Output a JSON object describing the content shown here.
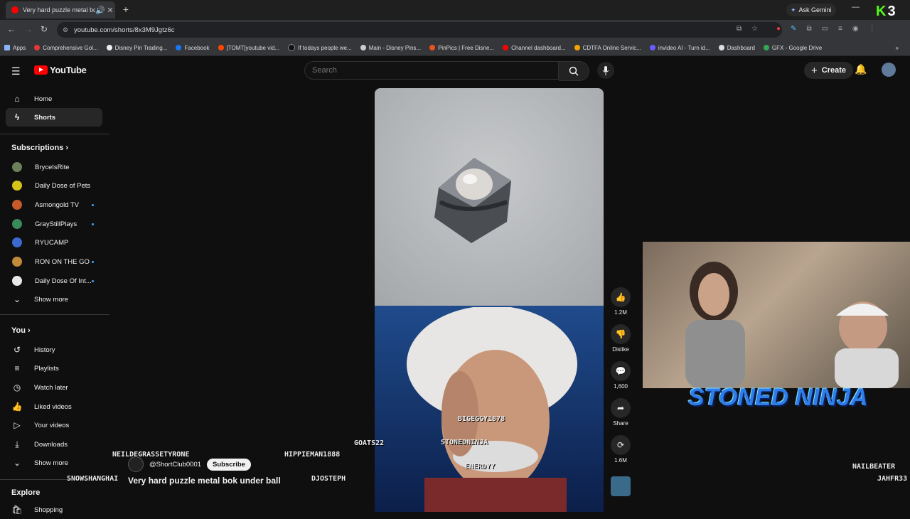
{
  "browser": {
    "tab_title": "Very hard puzzle metal bok",
    "ask_gemini": "Ask Gemini",
    "url": "youtube.com/shorts/8x3M9Jgtz6c",
    "bookmarks": [
      {
        "label": "Apps",
        "color": "#8ab4f8"
      },
      {
        "label": "Comprehensive Gol...",
        "color": "#e53935"
      },
      {
        "label": "Disney Pin Trading...",
        "color": "#eeeeee"
      },
      {
        "label": "Facebook",
        "color": "#1877f2"
      },
      {
        "label": "[TOMT]youtube vid...",
        "color": "#ff4500"
      },
      {
        "label": "If todays people we...",
        "color": "#111111"
      },
      {
        "label": "Main - Disney Pins...",
        "color": "#cccccc"
      },
      {
        "label": "PinPics | Free Disne...",
        "color": "#e8531f"
      },
      {
        "label": "Channel dashboard...",
        "color": "#ff0000"
      },
      {
        "label": "CDTFA Online Servic...",
        "color": "#f4a300"
      },
      {
        "label": "invideo AI - Turn id...",
        "color": "#6b5cff"
      },
      {
        "label": "Dashboard",
        "color": "#dddddd"
      },
      {
        "label": "GFX - Google Drive",
        "color": "#34a853"
      }
    ]
  },
  "header": {
    "logo_text": "YouTube",
    "search_placeholder": "Search",
    "create_label": "Create"
  },
  "sidebar": {
    "home": "Home",
    "shorts": "Shorts",
    "subscriptions_title": "Subscriptions",
    "subscriptions": [
      {
        "name": "BryceIsRite",
        "color": "#6a7f5a",
        "live": false
      },
      {
        "name": "Daily Dose of Pets",
        "color": "#d4c41a",
        "live": false
      },
      {
        "name": "Asmongold TV",
        "color": "#c55a2a",
        "live": true
      },
      {
        "name": "GrayStillPlays",
        "color": "#3a8a5a",
        "live": true
      },
      {
        "name": "RYUCAMP",
        "color": "#3a6ad0",
        "live": false
      },
      {
        "name": "RON ON THE GO",
        "color": "#c08a3a",
        "live": true
      },
      {
        "name": "Daily Dose Of Int...",
        "color": "#e8e8e8",
        "live": true
      }
    ],
    "show_more": "Show more",
    "you_title": "You",
    "you_items": [
      "History",
      "Playlists",
      "Watch later",
      "Liked videos",
      "Your videos",
      "Downloads"
    ],
    "show_more_2": "Show more",
    "explore_title": "Explore",
    "shopping": "Shopping"
  },
  "short": {
    "likes": "1.2M",
    "dislike": "Dislike",
    "comments": "1,600",
    "share": "Share",
    "remix": "1.6M",
    "channel": "@ShortClub0001",
    "subscribe": "Subscribe",
    "title": "Very hard puzzle metal bok under ball"
  },
  "overlay": {
    "streamer_name": "STONED NINJA",
    "chat_tags": [
      "NEILDEGRASSETYRONE",
      "HIPPIEMAN1888",
      "GOATS22",
      "BIGEGGY1878",
      "STONEDNINJA",
      "ENERDYY",
      "SNOWSHANGHAI",
      "DJOSTEPH",
      "NAILBEATER",
      "JAHFR33"
    ]
  }
}
